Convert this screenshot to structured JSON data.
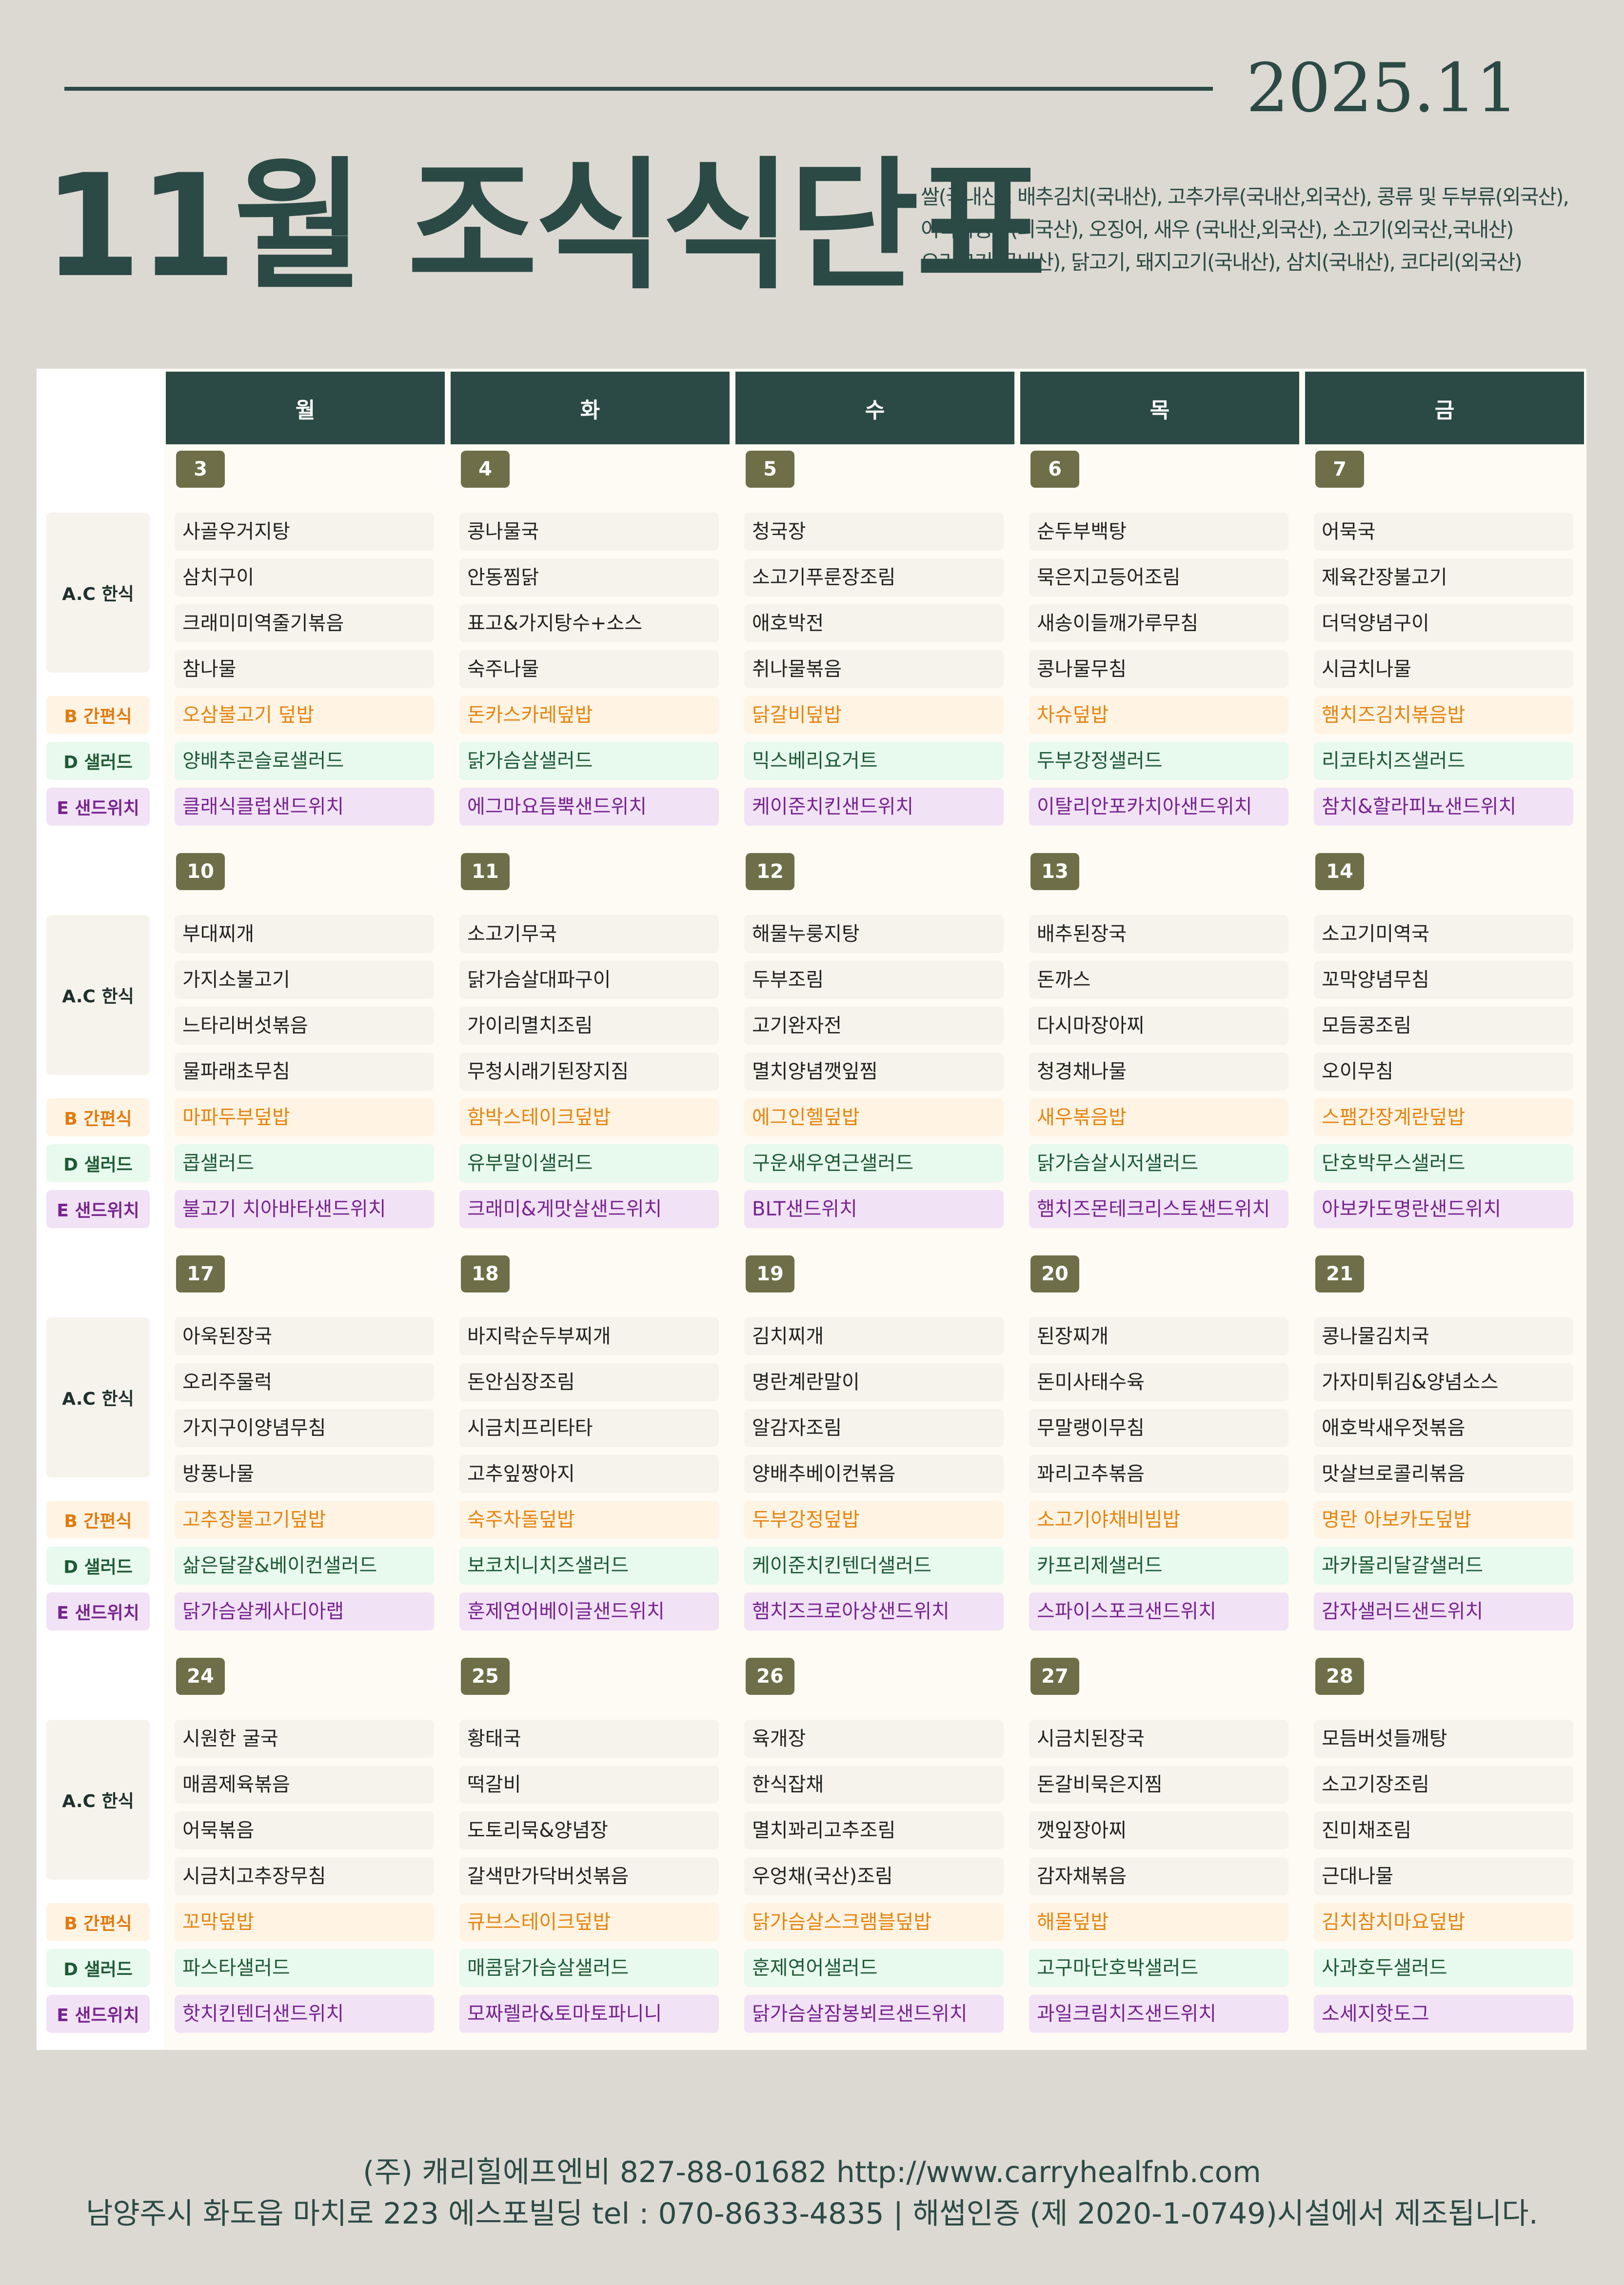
{
  "header": {
    "date": "2025.11",
    "title": "11월 조식식단표",
    "origin_lines": [
      "쌀(국내산), 배추김치(국내산), 고추가루(국내산,외국산), 콩류 및 두부류(외국산),",
      "어육가공품(외국산), 오징어, 새우 (국내산,외국산), 소고기(외국산,국내산)",
      "오리고기(국내산), 닭고기, 돼지고기(국내산), 삼치(국내산), 코다리(외국산)"
    ]
  },
  "days": [
    "월",
    "화",
    "수",
    "목",
    "금"
  ],
  "labels": {
    "ac": "A.C 한식",
    "b": "B 간편식",
    "d": "D 샐러드",
    "e": "E 샌드위치"
  },
  "weeks": [
    {
      "dates": [
        "3",
        "4",
        "5",
        "6",
        "7"
      ],
      "ac": [
        [
          "사골우거지탕",
          "삼치구이",
          "크래미미역줄기볶음",
          "참나물"
        ],
        [
          "콩나물국",
          "안동찜닭",
          "표고&가지탕수+소스",
          "숙주나물"
        ],
        [
          "청국장",
          "소고기푸룬장조림",
          "애호박전",
          "취나물볶음"
        ],
        [
          "순두부백탕",
          "묵은지고등어조림",
          "새송이들깨가루무침",
          "콩나물무침"
        ],
        [
          "어묵국",
          "제육간장불고기",
          "더덕양념구이",
          "시금치나물"
        ]
      ],
      "b": [
        "오삼불고기 덮밥",
        "돈카스카레덮밥",
        "닭갈비덮밥",
        "차슈덮밥",
        "햄치즈김치볶음밥"
      ],
      "d": [
        "양배추콘슬로샐러드",
        "닭가슴살샐러드",
        "믹스베리요거트",
        "두부강정샐러드",
        "리코타치즈샐러드"
      ],
      "e": [
        "클래식클럽샌드위치",
        "에그마요듬뿍샌드위치",
        "케이준치킨샌드위치",
        "이탈리안포카치아샌드위치",
        "참치&할라피뇨샌드위치"
      ]
    },
    {
      "dates": [
        "10",
        "11",
        "12",
        "13",
        "14"
      ],
      "ac": [
        [
          "부대찌개",
          "가지소불고기",
          "느타리버섯볶음",
          "물파래초무침"
        ],
        [
          "소고기무국",
          "닭가슴살대파구이",
          "가이리멸치조림",
          "무청시래기된장지짐"
        ],
        [
          "해물누룽지탕",
          "두부조림",
          "고기완자전",
          "멸치양념깻잎찜"
        ],
        [
          "배추된장국",
          "돈까스",
          "다시마장아찌",
          "청경채나물"
        ],
        [
          "소고기미역국",
          "꼬막양념무침",
          "모듬콩조림",
          "오이무침"
        ]
      ],
      "b": [
        "마파두부덮밥",
        "함박스테이크덮밥",
        "에그인헬덮밥",
        "새우볶음밥",
        "스팸간장계란덮밥"
      ],
      "d": [
        "콥샐러드",
        "유부말이샐러드",
        "구운새우연근샐러드",
        "닭가슴살시저샐러드",
        "단호박무스샐러드"
      ],
      "e": [
        "불고기 치아바타샌드위치",
        "크래미&게맛살샌드위치",
        "BLT샌드위치",
        "햄치즈몬테크리스토샌드위치",
        "아보카도명란샌드위치"
      ]
    },
    {
      "dates": [
        "17",
        "18",
        "19",
        "20",
        "21"
      ],
      "ac": [
        [
          "아욱된장국",
          "오리주물럭",
          "가지구이양념무침",
          "방풍나물"
        ],
        [
          "바지락순두부찌개",
          "돈안심장조림",
          "시금치프리타타",
          "고추잎짱아지"
        ],
        [
          "김치찌개",
          "명란계란말이",
          "알감자조림",
          "양배추베이컨볶음"
        ],
        [
          "된장찌개",
          "돈미사태수육",
          "무말랭이무침",
          "꽈리고추볶음"
        ],
        [
          "콩나물김치국",
          "가자미튀김&양념소스",
          "애호박새우젓볶음",
          "맛살브로콜리볶음"
        ]
      ],
      "b": [
        "고추장불고기덮밥",
        "숙주차돌덮밥",
        "두부강정덮밥",
        "소고기야채비빔밥",
        "명란 아보카도덮밥"
      ],
      "d": [
        "삶은달걀&베이컨샐러드",
        "보코치니치즈샐러드",
        "케이준치킨텐더샐러드",
        "카프리제샐러드",
        "과카몰리달걀샐러드"
      ],
      "e": [
        "닭가슴살케사디아랩",
        "훈제연어베이글샌드위치",
        "햄치즈크로아상샌드위치",
        "스파이스포크샌드위치",
        "감자샐러드샌드위치"
      ]
    },
    {
      "dates": [
        "24",
        "25",
        "26",
        "27",
        "28"
      ],
      "ac": [
        [
          "시원한 굴국",
          "매콤제육볶음",
          "어묵볶음",
          "시금치고추장무침"
        ],
        [
          "황태국",
          "떡갈비",
          "도토리묵&양념장",
          "갈색만가닥버섯볶음"
        ],
        [
          "육개장",
          "한식잡채",
          "멸치꽈리고추조림",
          "우엉채(국산)조림"
        ],
        [
          "시금치된장국",
          "돈갈비묵은지찜",
          "깻잎장아찌",
          "감자채볶음"
        ],
        [
          "모듬버섯들깨탕",
          "소고기장조림",
          "진미채조림",
          "근대나물"
        ]
      ],
      "b": [
        "꼬막덮밥",
        "큐브스테이크덮밥",
        "닭가슴살스크램블덮밥",
        "해물덮밥",
        "김치참치마요덮밥"
      ],
      "d": [
        "파스타샐러드",
        "매콤닭가슴살샐러드",
        "훈제연어샐러드",
        "고구마단호박샐러드",
        "사과호두샐러드"
      ],
      "e": [
        "핫치킨텐더샌드위치",
        "모짜렐라&토마토파니니",
        "닭가슴살잠봉뵈르샌드위치",
        "과일크림치즈샌드위치",
        "소세지핫도그"
      ]
    }
  ],
  "footer": {
    "line1": "(주) 캐리힐에프엔비 827-88-01682 http://www.carryhealfnb.com",
    "line2": "남양주시 화도읍 마치로 223 에스포빌딩 tel : 070-8633-4835 | 해썹인증 (제 2020-1-0749)시설에서 제조됩니다."
  },
  "colors": {
    "primary": "#2c4a45",
    "badge": "#6e6e48",
    "b_text": "#e5850f",
    "d_text": "#1f5a35",
    "e_text": "#77248f"
  }
}
